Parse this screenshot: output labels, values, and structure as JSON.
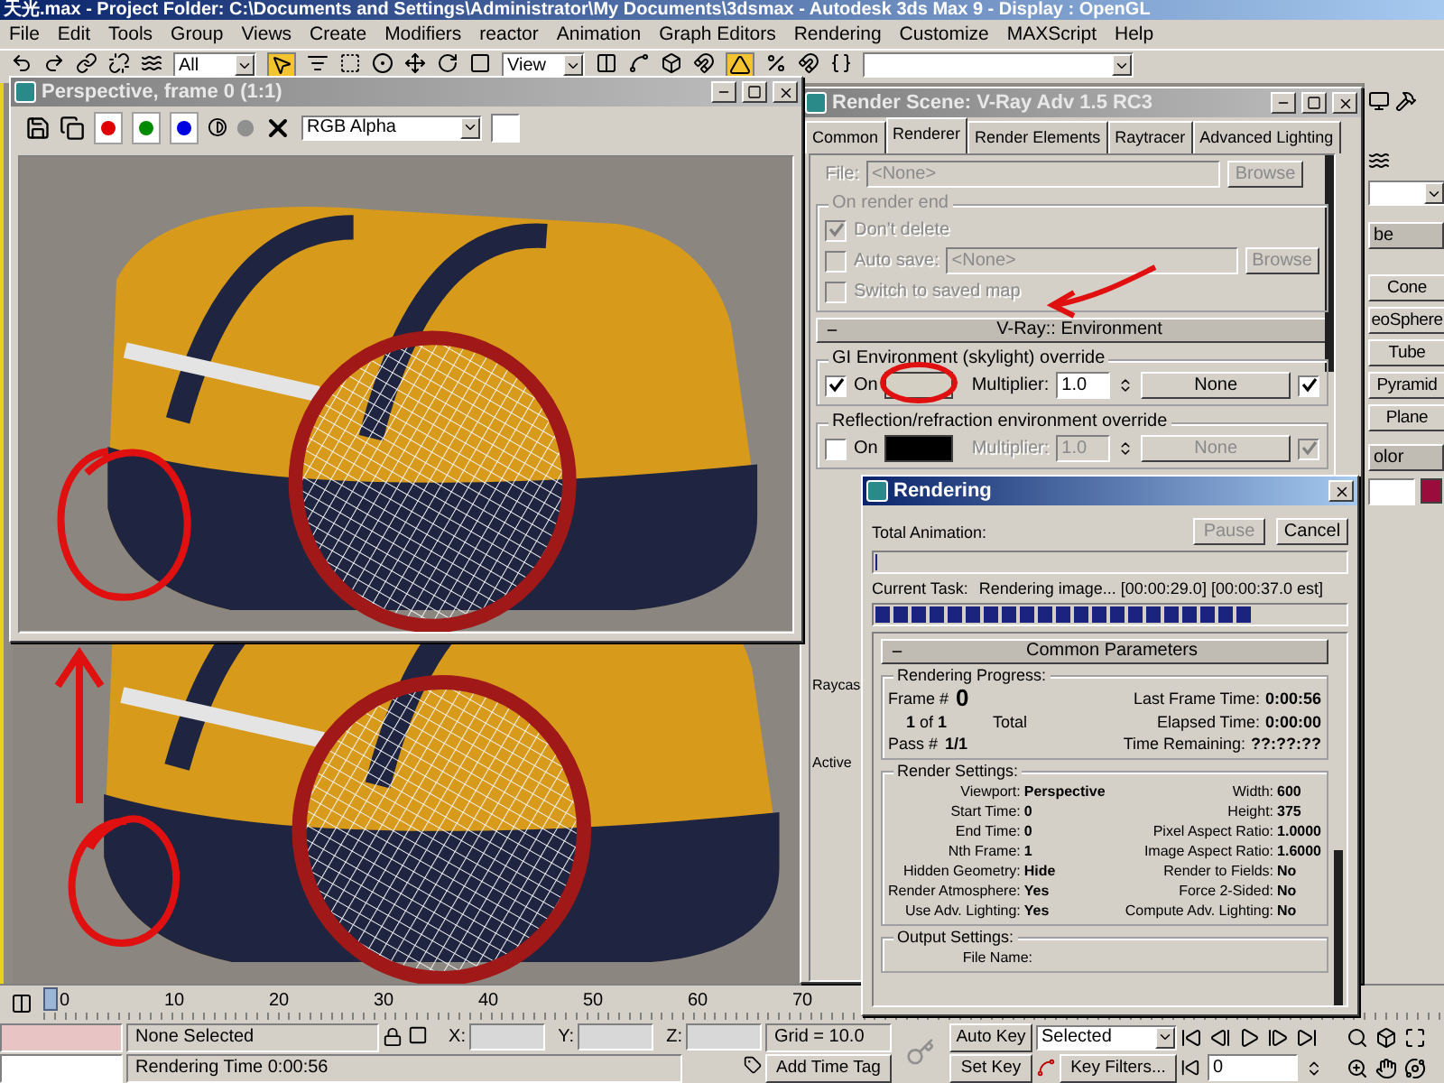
{
  "title_bar": {
    "title": "天光.max    - Project Folder: C:\\Documents and Settings\\Administrator\\My Documents\\3dsmax     - Autodesk 3ds Max 9     - Display : OpenGL"
  },
  "menu": [
    "File",
    "Edit",
    "Tools",
    "Group",
    "Views",
    "Create",
    "Modifiers",
    "reactor",
    "Animation",
    "Graph Editors",
    "Rendering",
    "Customize",
    "MAXScript",
    "Help"
  ],
  "toolbar": {
    "selection_filter": "All",
    "coordinate_system": "View"
  },
  "frame_window": {
    "title": "Perspective, frame 0 (1:1)",
    "display": "RGB Alpha",
    "channels": [
      {
        "color": "#e00000",
        "selected": true
      },
      {
        "color": "#008a00",
        "selected": true
      },
      {
        "color": "#0000e0",
        "selected": true
      }
    ]
  },
  "render_scene": {
    "title": "Render Scene: V-Ray Adv 1.5 RC3",
    "tabs": [
      {
        "label": "Common",
        "selected": false
      },
      {
        "label": "Renderer",
        "selected": true
      },
      {
        "label": "Render Elements",
        "selected": false
      },
      {
        "label": "Raytracer",
        "selected": false
      },
      {
        "label": "Advanced Lighting",
        "selected": false
      }
    ],
    "output": {
      "disabled": true,
      "file_label": "File:",
      "file_value": "<None>",
      "browse": "Browse",
      "group": "On render end",
      "dont_delete": {
        "label": "Don't delete",
        "checked": true
      },
      "auto_save": {
        "label": "Auto save:",
        "checked": false,
        "value": "<None>",
        "browse": "Browse"
      },
      "switch_map": {
        "label": "Switch to saved map",
        "checked": false
      }
    },
    "rollout": "V-Ray:: Environment",
    "overrides": [
      {
        "group": "GI Environment (skylight) override",
        "on": true,
        "on_label": "On",
        "color": "#d4d0c4",
        "multiplier_label": "Multiplier:",
        "multiplier": "1.0",
        "map": "None",
        "map_on": true
      },
      {
        "group": "Reflection/refraction environment override",
        "on": false,
        "on_label": "On",
        "color": "#000000",
        "multiplier_label": "Multiplier:",
        "multiplier": "1.0",
        "map": "None",
        "map_on": true
      }
    ],
    "side_labels": [
      "Raycas",
      "Active"
    ]
  },
  "command_panel": {
    "rollouts": [
      "be",
      "olor"
    ],
    "buttons": [
      "Cone",
      "eoSphere",
      "Tube",
      "Pyramid",
      "Plane"
    ],
    "color": "#9a0c3c"
  },
  "rendering": {
    "title": "Rendering",
    "pause": {
      "label": "Pause",
      "disabled": true
    },
    "cancel": "Cancel",
    "total": {
      "label": "Total Animation:",
      "level": 0
    },
    "task": {
      "label": "Current Task:",
      "text": "Rendering image... [00:00:29.0] [00:00:37.0 est]",
      "level": 0.81
    },
    "rollout": "Common Parameters",
    "progress": {
      "title": "Rendering Progress:",
      "frame_label": "Frame #",
      "frame": "0",
      "of": "**1** of **1**",
      "total": "Total",
      "pass_label": "Pass #",
      "pass": "1/1",
      "times": [
        {
          "label": "Last Frame Time:",
          "value": "0:00:56"
        },
        {
          "label": "Elapsed Time:",
          "value": "0:00:00"
        },
        {
          "label": "Time Remaining:",
          "value": "??:??:??"
        }
      ]
    },
    "settings": {
      "title": "Render Settings:",
      "rows": [
        {
          "label": "Viewport:",
          "value": "Perspective",
          "label_2": "Width:",
          "value_2": "600"
        },
        {
          "label": "Start Time:",
          "value": "0",
          "label_2": "Height:",
          "value_2": "375"
        },
        {
          "label": "End Time:",
          "value": "0",
          "label_2": "Pixel Aspect Ratio:",
          "value_2": "1.0000"
        },
        {
          "label": "Nth Frame:",
          "value": "1",
          "label_2": "Image Aspect Ratio:",
          "value_2": "1.6000"
        },
        {
          "label": "Hidden Geometry:",
          "value": "Hide",
          "label_2": "Render to Fields:",
          "value_2": "No"
        },
        {
          "label": "Render Atmosphere:",
          "value": "Yes",
          "label_2": "Force 2-Sided:",
          "value_2": "No"
        },
        {
          "label": "Use Adv. Lighting:",
          "value": "Yes",
          "label_2": "Compute Adv. Lighting:",
          "value_2": "No"
        }
      ]
    },
    "output": {
      "title": "Output Settings:",
      "fields": [
        "File Name:"
      ]
    }
  },
  "timeline": {
    "ticks": [
      "0",
      "10",
      "20",
      "30",
      "40",
      "50",
      "60",
      "70"
    ],
    "level": 0
  },
  "status": {
    "selection": "None Selected",
    "x_label": "X:",
    "y_label": "Y:",
    "z_label": "Z:",
    "grid": "Grid = 10.0",
    "prompt": "Rendering Time  0:00:56",
    "time_tag": "Add Time Tag",
    "auto_key": "Auto Key",
    "key_mode": "Selected",
    "set_key": "Set Key",
    "key_filters": "Key Filters...",
    "frame": "0"
  }
}
